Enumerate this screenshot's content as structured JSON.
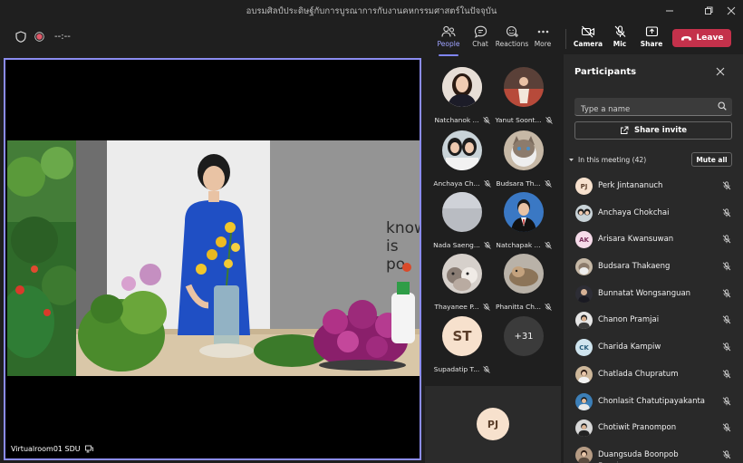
{
  "window": {
    "title": "อบรมศิลป์ประดิษฐ์กับการบูรณาการกับงานคหกรรมศาสตร์ในปัจจุบัน",
    "controls": [
      "minimize",
      "maximize",
      "close"
    ]
  },
  "toolbar": {
    "timer": "--:--",
    "buttons": {
      "people": "People",
      "chat": "Chat",
      "reactions": "Reactions",
      "more": "More",
      "camera": "Camera",
      "mic": "Mic",
      "share": "Share"
    },
    "leave": "Leave",
    "accent_color": "#7f85f5",
    "leave_color": "#c4314b"
  },
  "stage": {
    "name": "Virtualroom01 SDU",
    "background_sign": "know\nis\npo"
  },
  "gallery": {
    "tiles": [
      {
        "name": "Natchanok ...",
        "avatar": "photo"
      },
      {
        "name": "Yanut Soont...",
        "avatar": "photo"
      },
      {
        "name": "Anchaya Ch...",
        "avatar": "photo"
      },
      {
        "name": "Budsara Th...",
        "avatar": "photo"
      },
      {
        "name": "Nada Saeng...",
        "avatar": "photo"
      },
      {
        "name": "Natchapak ...",
        "avatar": "photo"
      },
      {
        "name": "Thayanee P...",
        "avatar": "photo"
      },
      {
        "name": "Phanitta Ch...",
        "avatar": "photo"
      },
      {
        "name": "Supadatip T...",
        "avatar": "ST"
      }
    ],
    "overflow": "+31",
    "self_initials": "PJ"
  },
  "participants": {
    "title": "Participants",
    "search_placeholder": "Type a name",
    "share_invite": "Share invite",
    "section_label": "In this meeting (42)",
    "mute_all": "Mute all",
    "list": [
      {
        "name": "Perk Jintananuch",
        "initials": "PJ",
        "role": ""
      },
      {
        "name": "Anchaya Chokchai",
        "initials": "",
        "role": ""
      },
      {
        "name": "Arisara Kwansuwan",
        "initials": "AK",
        "role": ""
      },
      {
        "name": "Budsara Thakaeng",
        "initials": "",
        "role": ""
      },
      {
        "name": "Bunnatat Wongsanguan",
        "initials": "",
        "role": ""
      },
      {
        "name": "Chanon Pramjai",
        "initials": "",
        "role": ""
      },
      {
        "name": "Charida Kampiw",
        "initials": "CK",
        "role": ""
      },
      {
        "name": "Chatlada Chupratum",
        "initials": "",
        "role": ""
      },
      {
        "name": "Chonlasit Chatutipayakanta",
        "initials": "",
        "role": ""
      },
      {
        "name": "Chotiwit Pranompon",
        "initials": "",
        "role": ""
      },
      {
        "name": "Duangsuda Boonpob",
        "initials": "",
        "role": "Organizer"
      }
    ]
  }
}
